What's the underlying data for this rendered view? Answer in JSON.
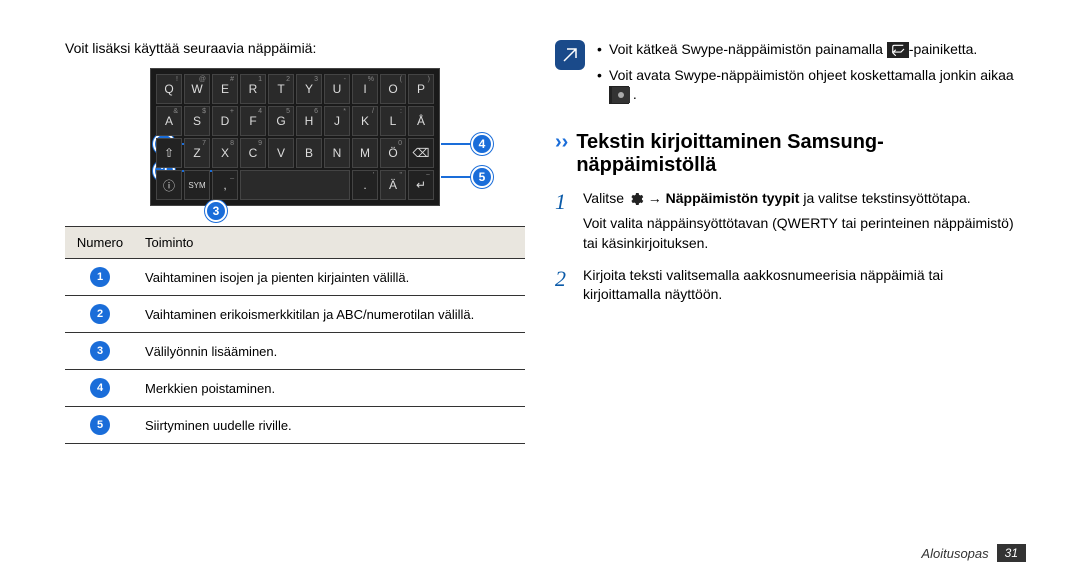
{
  "left": {
    "intro": "Voit lisäksi käyttää seuraavia näppäimiä:",
    "keyboard": {
      "rows": [
        [
          {
            "main": "Q",
            "sup": "!"
          },
          {
            "main": "W",
            "sup": "@"
          },
          {
            "main": "E",
            "sup": "#"
          },
          {
            "main": "R",
            "sup": "1"
          },
          {
            "main": "T",
            "sup": "2"
          },
          {
            "main": "Y",
            "sup": "3"
          },
          {
            "main": "U",
            "sup": "-"
          },
          {
            "main": "I",
            "sup": "%"
          },
          {
            "main": "O",
            "sup": "("
          },
          {
            "main": "P",
            "sup": ")"
          }
        ],
        [
          {
            "main": "A",
            "sup": "&"
          },
          {
            "main": "S",
            "sup": "$"
          },
          {
            "main": "D",
            "sup": "+"
          },
          {
            "main": "F",
            "sup": "4"
          },
          {
            "main": "G",
            "sup": "5"
          },
          {
            "main": "H",
            "sup": "6"
          },
          {
            "main": "J",
            "sup": "*"
          },
          {
            "main": "K",
            "sup": "/"
          },
          {
            "main": "L",
            "sup": ":"
          },
          {
            "main": "Å",
            "sup": ""
          }
        ],
        [
          {
            "main": "⇧",
            "cls": "shift"
          },
          {
            "main": "Z",
            "sup": "7"
          },
          {
            "main": "X",
            "sup": "8"
          },
          {
            "main": "C",
            "sup": "9"
          },
          {
            "main": "V",
            "sup": ""
          },
          {
            "main": "B",
            "sup": ""
          },
          {
            "main": "N",
            "sup": ""
          },
          {
            "main": "M",
            "sup": ""
          },
          {
            "main": "Ö",
            "sup": "0"
          },
          {
            "main": "⌫",
            "cls": "back"
          }
        ],
        [
          {
            "main": "ⓘ",
            "cls": "info"
          },
          {
            "main": "SYM",
            "cls": "sym"
          },
          {
            "main": ",",
            "sup": "_",
            "cls": "comma"
          },
          {
            "main": " ",
            "cls": "space"
          },
          {
            "main": ".",
            "sup": "'",
            "cls": "dot"
          },
          {
            "main": "Ä",
            "sup": "\""
          },
          {
            "main": "↵",
            "sup": "~",
            "cls": "enter"
          }
        ]
      ]
    },
    "callouts": [
      "1",
      "2",
      "3",
      "4",
      "5"
    ],
    "table": {
      "head": {
        "num": "Numero",
        "func": "Toiminto"
      },
      "rows": [
        {
          "num": 1,
          "text": "Vaihtaminen isojen ja pienten kirjainten välillä."
        },
        {
          "num": 2,
          "text": "Vaihtaminen erikoismerkkitilan ja ABC/numerotilan välillä."
        },
        {
          "num": 3,
          "text": "Välilyönnin lisääminen."
        },
        {
          "num": 4,
          "text": "Merkkien poistaminen."
        },
        {
          "num": 5,
          "text": "Siirtyminen uudelle riville."
        }
      ]
    }
  },
  "right": {
    "note": {
      "items": [
        {
          "pre": "Voit kätkeä Swype-näppäimistön painamalla ",
          "post": "-painiketta."
        },
        {
          "pre": "Voit avata Swype-näppäimistön ohjeet koskettamalla jonkin aikaa ",
          "post": " ."
        }
      ]
    },
    "section_title": "Tekstin kirjoittaminen Samsung-näppäimistöllä",
    "steps": [
      {
        "num": "1",
        "pre": "Valitse ",
        "arrow": " → ",
        "bold": "Näppäimistön tyypit",
        "mid": " ja valitse tekstinsyöttötapa.",
        "detail": "Voit valita näppäinsyöttötavan (QWERTY tai perinteinen näppäimistö) tai käsinkirjoituksen."
      },
      {
        "num": "2",
        "text": "Kirjoita teksti valitsemalla aakkosnumeerisia näppäimiä tai kirjoittamalla näyttöön."
      }
    ]
  },
  "footer": {
    "label": "Aloitusopas",
    "page": "31"
  }
}
